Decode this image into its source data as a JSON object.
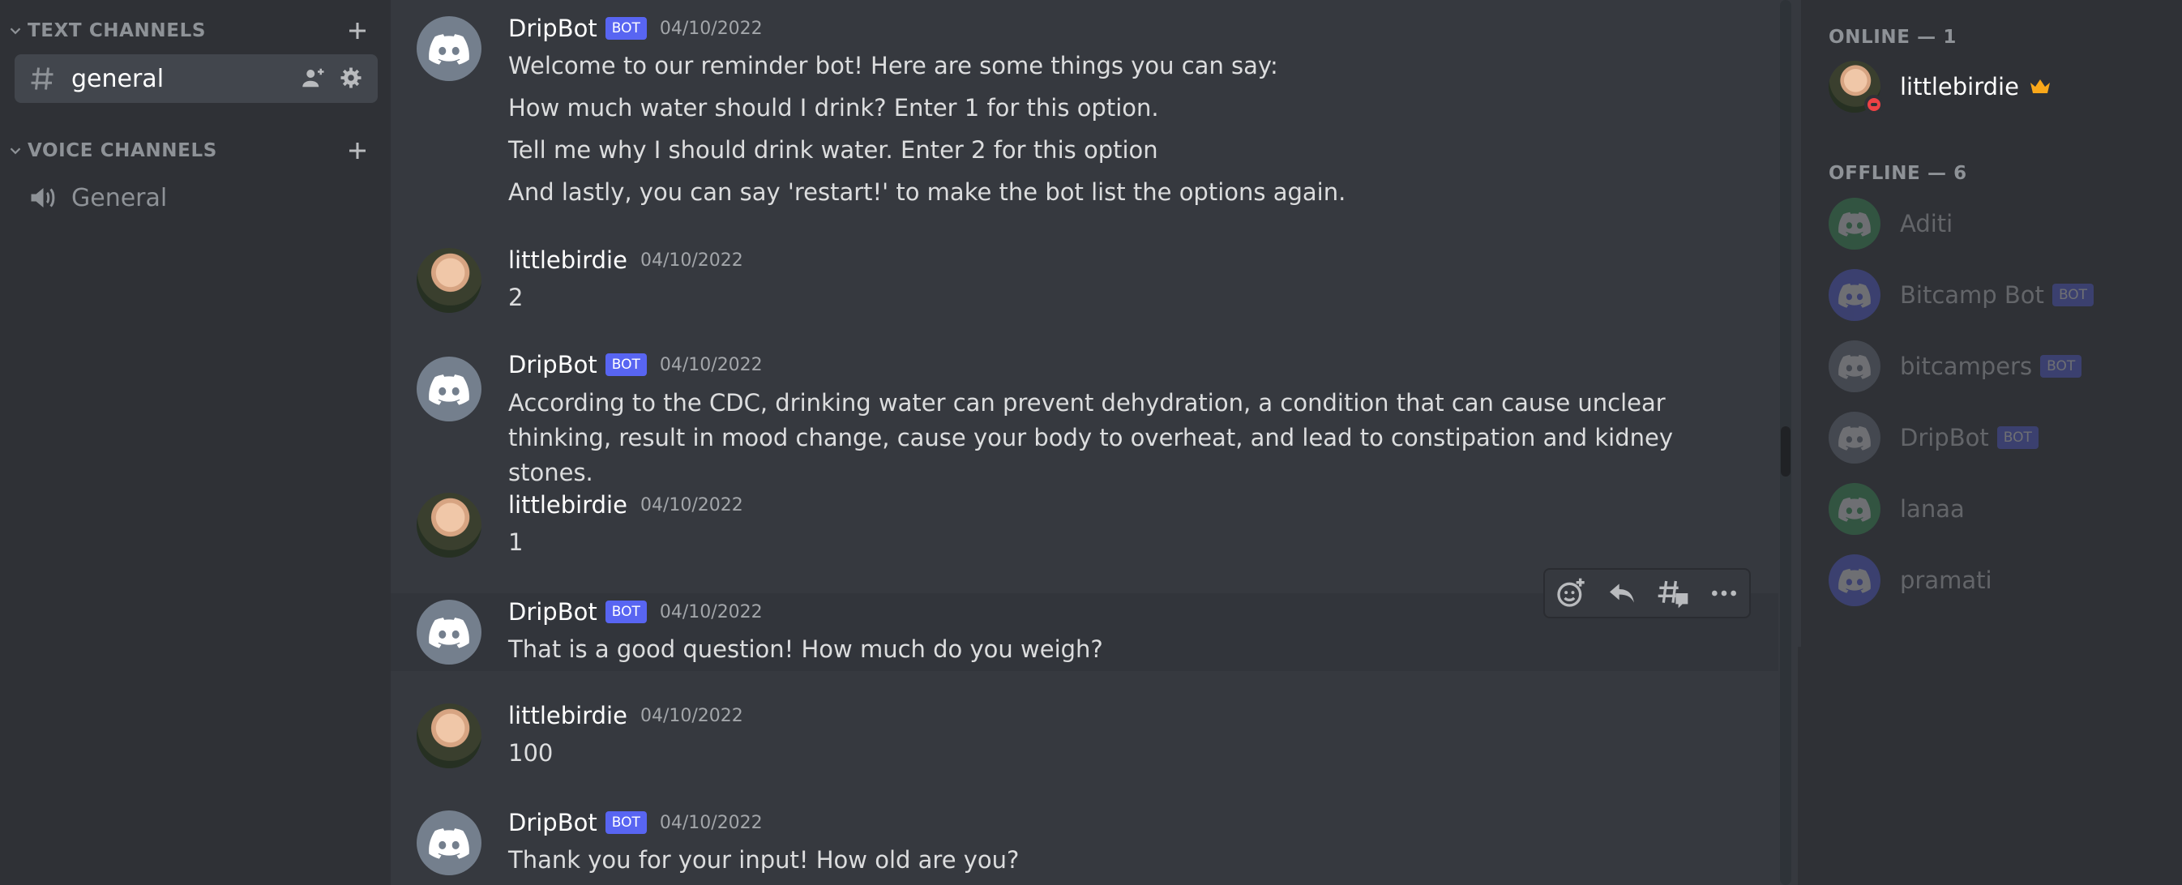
{
  "sidebar": {
    "text_category": "TEXT CHANNELS",
    "voice_category": "VOICE CHANNELS",
    "text_channels": [
      {
        "label": "general",
        "icon": "hash-icon"
      }
    ],
    "voice_channels": [
      {
        "label": "General",
        "icon": "speaker-icon"
      }
    ]
  },
  "messages": [
    {
      "author": "DripBot",
      "bot": "BOT",
      "timestamp": "04/10/2022",
      "avatar": "discord-logo",
      "lines": [
        "Welcome to our reminder bot! Here are some things you can say:",
        "How much water should I drink? Enter 1 for this option.",
        "Tell me why I should drink water. Enter 2 for this option",
        "And lastly, you can say 'restart!' to make the bot list the options again."
      ]
    },
    {
      "author": "littlebirdie",
      "timestamp": "04/10/2022",
      "avatar": "photo",
      "lines": [
        "2"
      ]
    },
    {
      "author": "DripBot",
      "bot": "BOT",
      "timestamp": "04/10/2022",
      "avatar": "discord-logo",
      "lines": [
        "According to the CDC, drinking water can prevent dehydration, a condition that can cause unclear thinking, result in mood change, cause your body to overheat, and lead to constipation and kidney stones."
      ]
    },
    {
      "author": "littlebirdie",
      "timestamp": "04/10/2022",
      "avatar": "photo",
      "lines": [
        "1"
      ]
    },
    {
      "author": "DripBot",
      "bot": "BOT",
      "timestamp": "04/10/2022",
      "avatar": "discord-logo",
      "lines": [
        "That is a good question! How much do you weigh?"
      ]
    },
    {
      "author": "littlebirdie",
      "timestamp": "04/10/2022",
      "avatar": "photo",
      "lines": [
        "100"
      ]
    },
    {
      "author": "DripBot",
      "bot": "BOT",
      "timestamp": "04/10/2022",
      "avatar": "discord-logo",
      "lines": [
        "Thank you for your input! How old are you?"
      ]
    }
  ],
  "toolbar": {
    "icons": [
      "add-reaction-icon",
      "reply-icon",
      "create-thread-icon",
      "more-icon"
    ]
  },
  "members": {
    "online_title": "ONLINE — 1",
    "offline_title": "OFFLINE — 6",
    "online": [
      {
        "name": "littlebirdie",
        "status": "dnd",
        "owner": true
      }
    ],
    "offline": [
      {
        "name": "Aditi",
        "color": "#3ba55c"
      },
      {
        "name": "Bitcamp Bot",
        "bot": "BOT",
        "color": "#5865f2"
      },
      {
        "name": "bitcampers",
        "bot": "BOT",
        "color": "#747f8d"
      },
      {
        "name": "DripBot",
        "bot": "BOT",
        "color": "#747f8d"
      },
      {
        "name": "lanaa",
        "color": "#3ba55c"
      },
      {
        "name": "pramati",
        "color": "#5865f2"
      }
    ]
  },
  "colors": {
    "background": "#36393f",
    "sidebar": "#2f3136",
    "blurple": "#5865f2",
    "dnd": "#ed4245",
    "crown": "#faa81a"
  }
}
